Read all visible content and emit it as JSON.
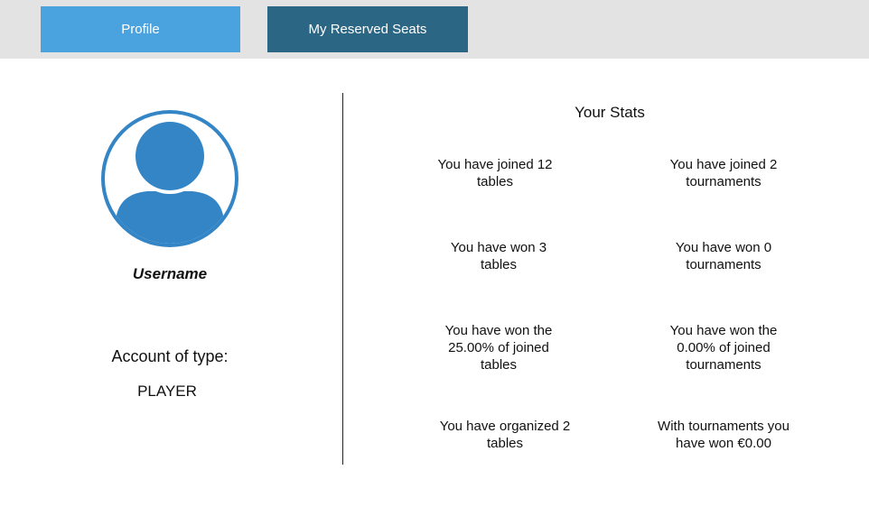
{
  "tabs": [
    {
      "label": "Profile"
    },
    {
      "label": "My Reserved Seats"
    }
  ],
  "profile": {
    "username": "Username",
    "account_type_label": "Account of type:",
    "account_type": "PLAYER"
  },
  "stats": {
    "title": "Your Stats",
    "joined_tables": "You have joined 12 tables",
    "joined_tournaments": "You have joined 2 tournaments",
    "won_tables": "You have won 3 tables",
    "won_tournaments": "You have won 0 tournaments",
    "won_tables_pct": "You have won the 25.00% of joined tables",
    "won_tournaments_pct": "You have won the 0.00% of joined tournaments",
    "organized_tables": "You have organized 2 tables",
    "tournament_winnings": "With tournaments you have won €0.00"
  },
  "colors": {
    "topbar": "#e3e3e3",
    "tab_profile": "#4aa3de",
    "tab_reserved": "#2b6785",
    "avatar": "#3385c6"
  },
  "icons": {
    "avatar": "user-avatar-icon"
  }
}
